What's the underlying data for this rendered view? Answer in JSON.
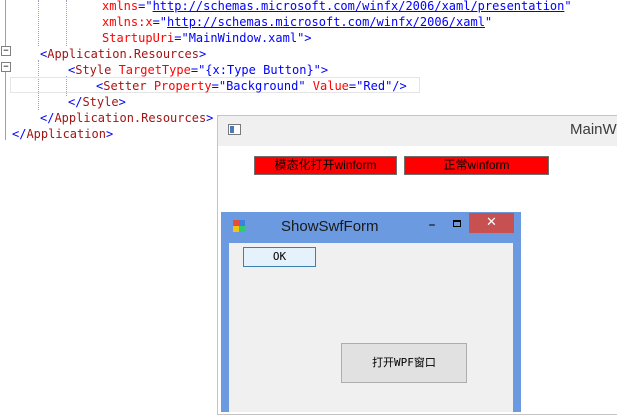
{
  "editor": {
    "lines": [
      {
        "parts": [
          {
            "cls": "a",
            "text": "xmlns"
          },
          {
            "cls": "p",
            "text": "=\""
          },
          {
            "cls": "u",
            "text": "http://schemas.microsoft.com/winfx/2006/xaml/presentation"
          },
          {
            "cls": "p",
            "text": "\""
          }
        ]
      },
      {
        "parts": [
          {
            "cls": "a",
            "text": "xmlns:x"
          },
          {
            "cls": "p",
            "text": "=\""
          },
          {
            "cls": "u",
            "text": "http://schemas.microsoft.com/winfx/2006/xaml"
          },
          {
            "cls": "p",
            "text": "\""
          }
        ]
      },
      {
        "parts": [
          {
            "cls": "a",
            "text": "StartupUri"
          },
          {
            "cls": "p",
            "text": "=\""
          },
          {
            "cls": "v",
            "text": "MainWindow.xaml"
          },
          {
            "cls": "p",
            "text": "\">"
          }
        ]
      },
      {
        "parts": [
          {
            "cls": "p",
            "text": "<"
          },
          {
            "cls": "t",
            "text": "Application.Resources"
          },
          {
            "cls": "p",
            "text": ">"
          }
        ]
      },
      {
        "parts": [
          {
            "cls": "p",
            "text": "<"
          },
          {
            "cls": "t",
            "text": "Style"
          },
          {
            "cls": "a",
            "text": " TargetType"
          },
          {
            "cls": "p",
            "text": "=\""
          },
          {
            "cls": "v",
            "text": "{x:Type Button}"
          },
          {
            "cls": "p",
            "text": "\">"
          }
        ]
      },
      {
        "parts": [
          {
            "cls": "p",
            "text": "<"
          },
          {
            "cls": "t",
            "text": "Setter"
          },
          {
            "cls": "a",
            "text": " Property"
          },
          {
            "cls": "p",
            "text": "=\""
          },
          {
            "cls": "v",
            "text": "Background"
          },
          {
            "cls": "p",
            "text": "\""
          },
          {
            "cls": "a",
            "text": " Value"
          },
          {
            "cls": "p",
            "text": "=\""
          },
          {
            "cls": "v",
            "text": "Red"
          },
          {
            "cls": "p",
            "text": "\"/>"
          }
        ]
      },
      {
        "parts": [
          {
            "cls": "p",
            "text": "</"
          },
          {
            "cls": "t",
            "text": "Style"
          },
          {
            "cls": "p",
            "text": ">"
          }
        ]
      },
      {
        "parts": [
          {
            "cls": "p",
            "text": "</"
          },
          {
            "cls": "t",
            "text": "Application.Resources"
          },
          {
            "cls": "p",
            "text": ">"
          }
        ]
      },
      {
        "parts": [
          {
            "cls": "p",
            "text": "</"
          },
          {
            "cls": "t",
            "text": "Application"
          },
          {
            "cls": "p",
            "text": ">"
          }
        ]
      }
    ],
    "outline_collapse_symbol": "−"
  },
  "main_window": {
    "title": "MainW",
    "buttons": [
      "模态化打开winform",
      "正常winform"
    ],
    "button_color": "#ff0000"
  },
  "swf_window": {
    "title": "ShowSwfForm",
    "minimize_glyph": "▬",
    "close_glyph": "✕",
    "ok_label": "OK",
    "open_wpf_label": "打开WPF窗口",
    "frame_color": "#6b9ae0",
    "close_color": "#c75050"
  }
}
